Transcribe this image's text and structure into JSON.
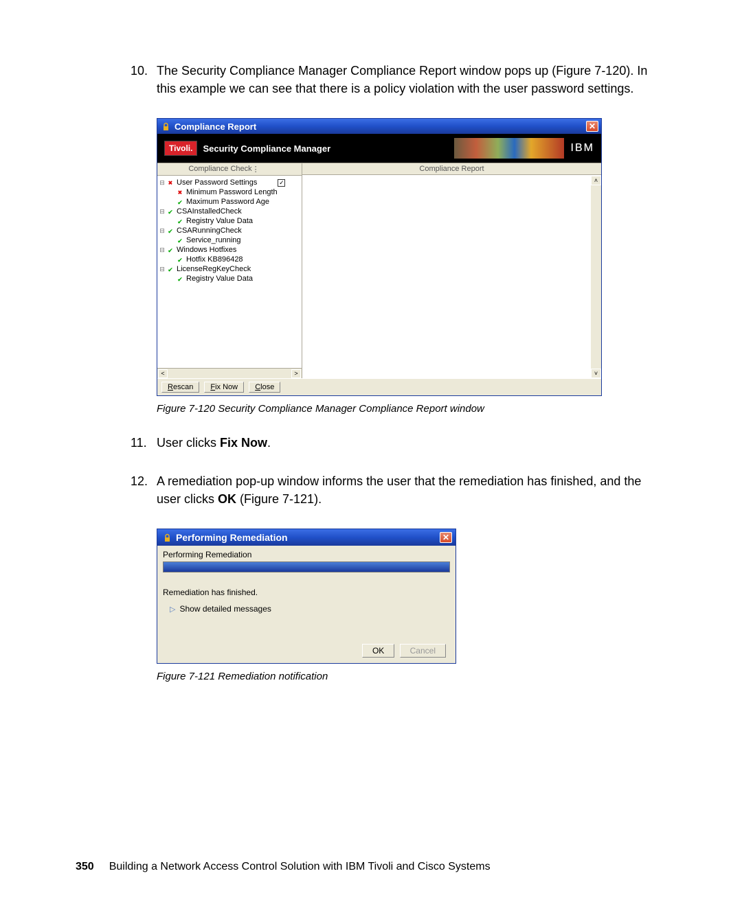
{
  "steps": {
    "s10_num": "10.",
    "s10": "The Security Compliance Manager Compliance Report window pops up (Figure 7-120). In this example we can see that there is a policy violation with the user password settings.",
    "s11_num": "11.",
    "s11_a": "User clicks ",
    "s11_b": "Fix Now",
    "s11_c": ".",
    "s12_num": "12.",
    "s12_a": "A remediation pop-up window informs the user that the remediation has finished, and the user clicks ",
    "s12_b": "OK",
    "s12_c": " (Figure 7-121)."
  },
  "fig120_caption": "Figure 7-120   Security Compliance Manager Compliance Report window",
  "fig121_caption": "Figure 7-121   Remediation notification",
  "win1": {
    "title": "Compliance Report",
    "banner_badge": "Tivoli.",
    "banner_text": "Security Compliance Manager",
    "ibm": "IBM",
    "col_left_head": "Compliance Check",
    "col_right_head": "Compliance Report",
    "tree": [
      {
        "tw": "⊟",
        "ico": "✖",
        "cls": "x-red",
        "label": "User Password Settings",
        "chk": true
      },
      {
        "tw": "",
        "ico": "✖",
        "cls": "x-red",
        "label": "Minimum Password Length",
        "indent": 1
      },
      {
        "tw": "",
        "ico": "✔",
        "cls": "chk-green",
        "label": "Maximum Password Age",
        "indent": 1
      },
      {
        "tw": "⊟",
        "ico": "✔",
        "cls": "chk-green",
        "label": "CSAInstalledCheck"
      },
      {
        "tw": "",
        "ico": "✔",
        "cls": "chk-green",
        "label": "Registry Value Data",
        "indent": 1
      },
      {
        "tw": "⊟",
        "ico": "✔",
        "cls": "chk-green",
        "label": "CSARunningCheck"
      },
      {
        "tw": "",
        "ico": "✔",
        "cls": "chk-green",
        "label": "Service_running",
        "indent": 1
      },
      {
        "tw": "⊟",
        "ico": "✔",
        "cls": "chk-green",
        "label": "Windows Hotfixes"
      },
      {
        "tw": "",
        "ico": "✔",
        "cls": "chk-green",
        "label": "Hotfix KB896428",
        "indent": 1
      },
      {
        "tw": "⊟",
        "ico": "✔",
        "cls": "chk-green",
        "label": "LicenseRegKeyCheck"
      },
      {
        "tw": "",
        "ico": "✔",
        "cls": "chk-green",
        "label": "Registry Value Data",
        "indent": 1
      }
    ],
    "buttons": {
      "rescan": "Rescan",
      "fixnow": "Fix Now",
      "close": "Close"
    }
  },
  "win2": {
    "title": "Performing Remediation",
    "label": "Performing Remediation",
    "msg": "Remediation has finished.",
    "expand": "Show detailed messages",
    "ok": "OK",
    "cancel": "Cancel"
  },
  "footer": {
    "page": "350",
    "text": "Building a Network Access Control Solution with IBM Tivoli and Cisco Systems"
  }
}
